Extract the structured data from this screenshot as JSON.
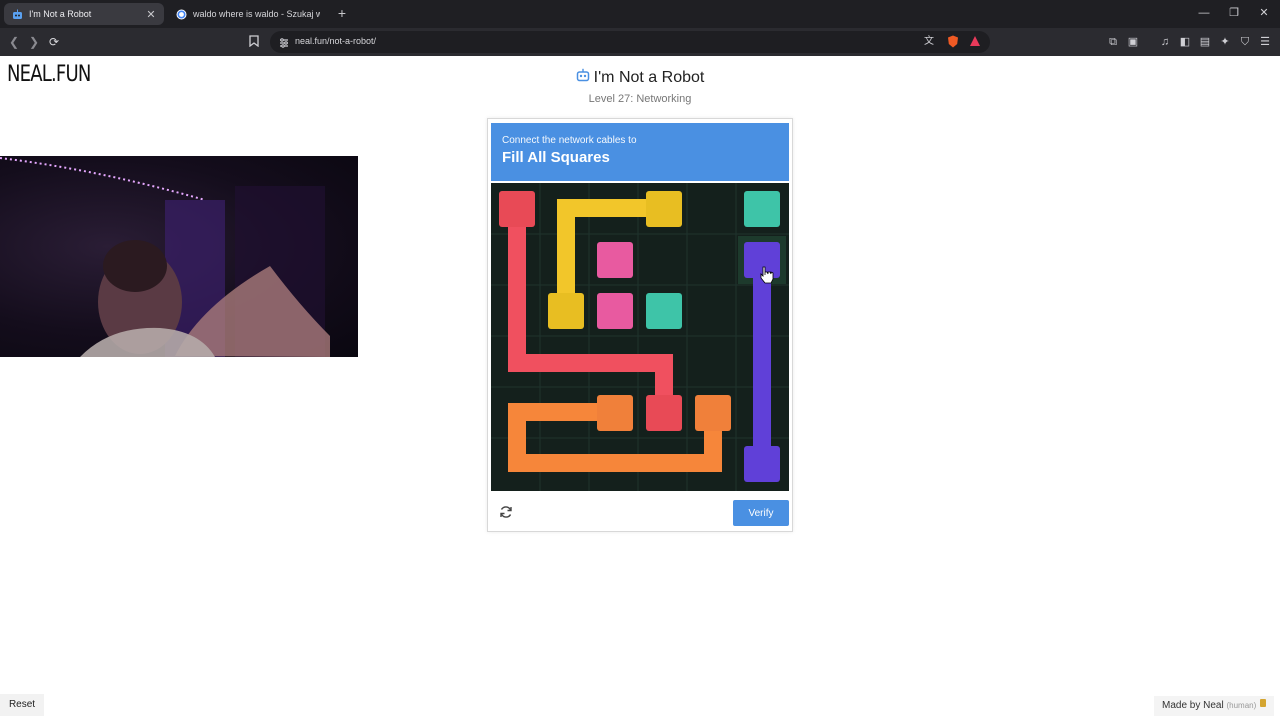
{
  "browser": {
    "tabs": [
      {
        "title": "I'm Not a Robot",
        "active": true
      },
      {
        "title": "waldo where is waldo - Szukaj w Goo",
        "active": false
      }
    ],
    "url": "neal.fun/not-a-robot/"
  },
  "site": {
    "logo": "NEAL.FUN",
    "title": "I'm Not a Robot",
    "level": "Level 27: Networking"
  },
  "captcha": {
    "instruction": "Connect the network cables to",
    "goal": "Fill All Squares",
    "verify_label": "Verify",
    "colors": {
      "header": "#4a90e2",
      "board": "#14201c",
      "red": "#f0505f",
      "yellow": "#f2c62a",
      "pink": "#e85aa0",
      "teal": "#3ec4a8",
      "purple": "#6040d8",
      "orange": "#f6863a"
    }
  },
  "footer": {
    "reset_label": "Reset",
    "made_by": "Made by Neal",
    "human": "(human)"
  }
}
